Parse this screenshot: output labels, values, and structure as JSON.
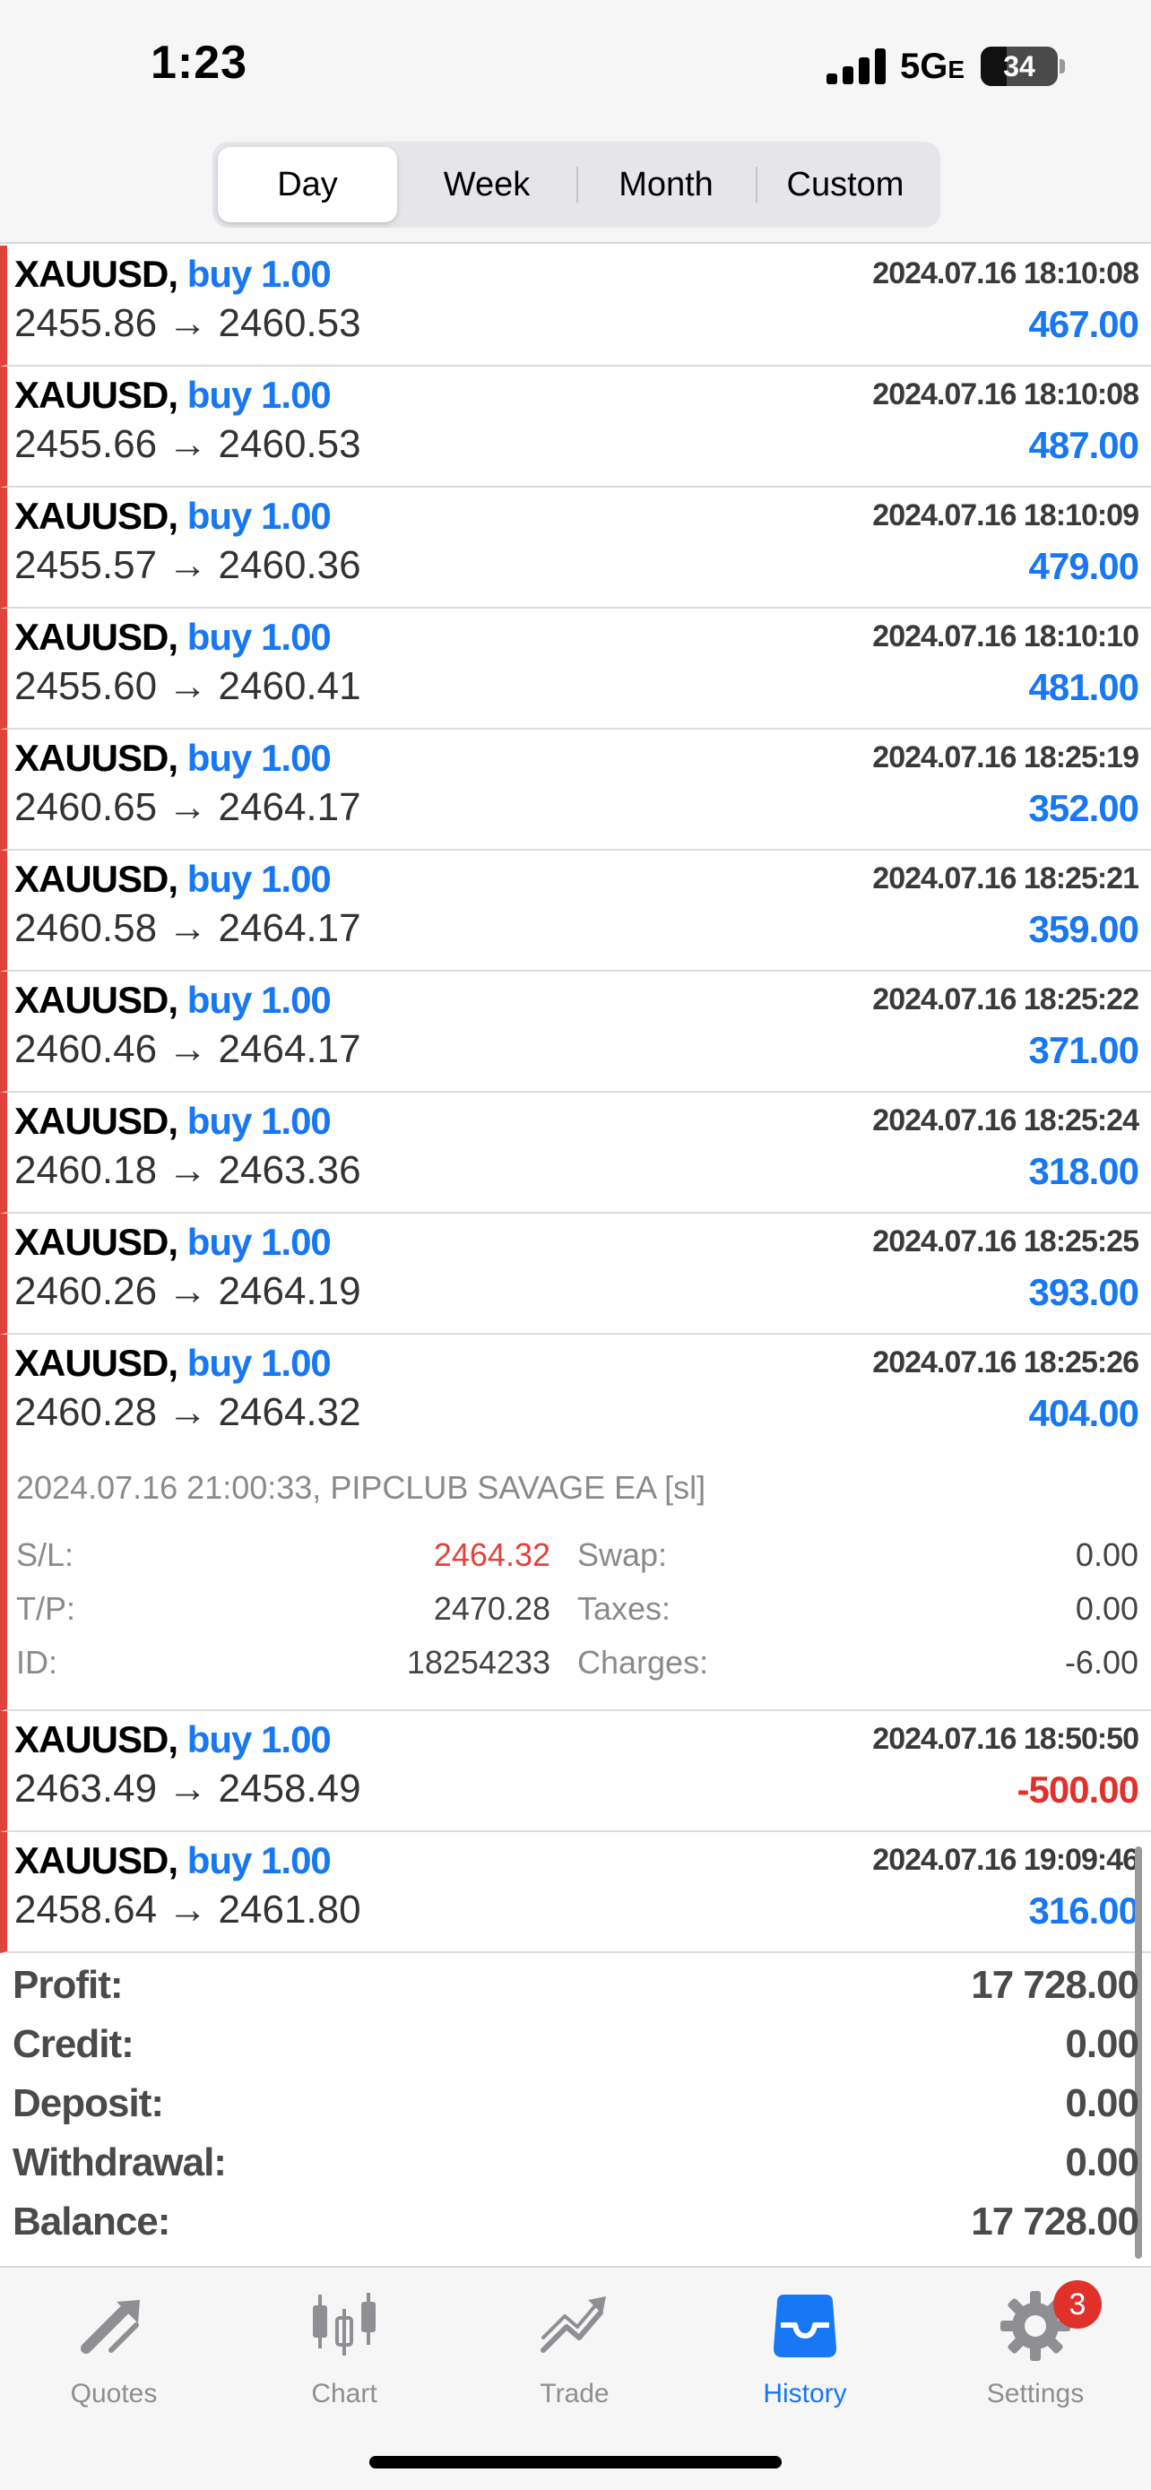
{
  "status_bar": {
    "time": "1:23",
    "network": "5G",
    "network_suffix": "E",
    "battery": "34",
    "battery_level": 0.34
  },
  "period_tabs": [
    {
      "label": "Day",
      "active": true
    },
    {
      "label": "Week",
      "active": false
    },
    {
      "label": "Month",
      "active": false
    },
    {
      "label": "Custom",
      "active": false
    }
  ],
  "deals": [
    {
      "symbol": "XAUUSD,",
      "side": "buy 1.00",
      "time": "2024.07.16 18:10:08",
      "open": "2455.86",
      "arrow": "→",
      "close": "2460.53",
      "profit": "467.00"
    },
    {
      "symbol": "XAUUSD,",
      "side": "buy 1.00",
      "time": "2024.07.16 18:10:08",
      "open": "2455.66",
      "arrow": "→",
      "close": "2460.53",
      "profit": "487.00"
    },
    {
      "symbol": "XAUUSD,",
      "side": "buy 1.00",
      "time": "2024.07.16 18:10:09",
      "open": "2455.57",
      "arrow": "→",
      "close": "2460.36",
      "profit": "479.00"
    },
    {
      "symbol": "XAUUSD,",
      "side": "buy 1.00",
      "time": "2024.07.16 18:10:10",
      "open": "2455.60",
      "arrow": "→",
      "close": "2460.41",
      "profit": "481.00"
    },
    {
      "symbol": "XAUUSD,",
      "side": "buy 1.00",
      "time": "2024.07.16 18:25:19",
      "open": "2460.65",
      "arrow": "→",
      "close": "2464.17",
      "profit": "352.00"
    },
    {
      "symbol": "XAUUSD,",
      "side": "buy 1.00",
      "time": "2024.07.16 18:25:21",
      "open": "2460.58",
      "arrow": "→",
      "close": "2464.17",
      "profit": "359.00"
    },
    {
      "symbol": "XAUUSD,",
      "side": "buy 1.00",
      "time": "2024.07.16 18:25:22",
      "open": "2460.46",
      "arrow": "→",
      "close": "2464.17",
      "profit": "371.00"
    },
    {
      "symbol": "XAUUSD,",
      "side": "buy 1.00",
      "time": "2024.07.16 18:25:24",
      "open": "2460.18",
      "arrow": "→",
      "close": "2463.36",
      "profit": "318.00"
    },
    {
      "symbol": "XAUUSD,",
      "side": "buy 1.00",
      "time": "2024.07.16 18:25:25",
      "open": "2460.26",
      "arrow": "→",
      "close": "2464.19",
      "profit": "393.00"
    },
    {
      "symbol": "XAUUSD,",
      "side": "buy 1.00",
      "time": "2024.07.16 18:25:26",
      "open": "2460.28",
      "arrow": "→",
      "close": "2464.32",
      "profit": "404.00"
    }
  ],
  "expanded_detail": {
    "comment": "2024.07.16 21:00:33, PIPCLUB SAVAGE EA [sl]",
    "sl_label": "S/L:",
    "sl_value": "2464.32",
    "tp_label": "T/P:",
    "tp_value": "2470.28",
    "id_label": "ID:",
    "id_value": "18254233",
    "swap_label": "Swap:",
    "swap_value": "0.00",
    "taxes_label": "Taxes:",
    "taxes_value": "0.00",
    "charges_label": "Charges:",
    "charges_value": "-6.00"
  },
  "deals_after": [
    {
      "symbol": "XAUUSD,",
      "side": "buy 1.00",
      "time": "2024.07.16 18:50:50",
      "open": "2463.49",
      "arrow": "→",
      "close": "2458.49",
      "profit": "-500.00"
    },
    {
      "symbol": "XAUUSD,",
      "side": "buy 1.00",
      "time": "2024.07.16 19:09:46",
      "open": "2458.64",
      "arrow": "→",
      "close": "2461.80",
      "profit": "316.00"
    }
  ],
  "summary": [
    {
      "label": "Profit:",
      "value": "17 728.00"
    },
    {
      "label": "Credit:",
      "value": "0.00"
    },
    {
      "label": "Deposit:",
      "value": "0.00"
    },
    {
      "label": "Withdrawal:",
      "value": "0.00"
    },
    {
      "label": "Balance:",
      "value": "17 728.00"
    }
  ],
  "tabbar": {
    "quotes": "Quotes",
    "chart": "Chart",
    "trade": "Trade",
    "history": "History",
    "settings": "Settings",
    "settings_badge": "3"
  },
  "colors": {
    "accent": "#1877f2",
    "loss": "#e0322b",
    "row_marker": "#e0433b"
  }
}
